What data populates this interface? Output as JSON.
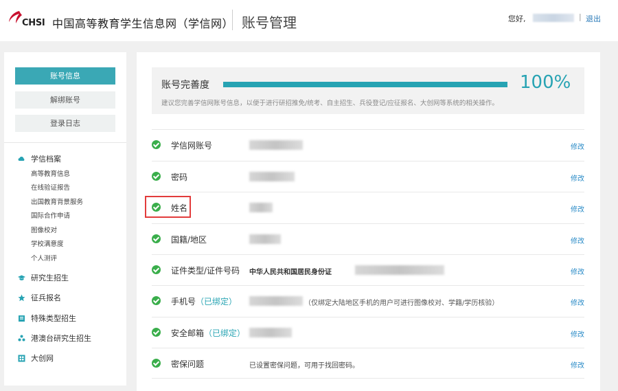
{
  "header": {
    "logo_text": "CHSI",
    "site_name": "中国高等教育学生信息网（学信网）",
    "page_title": "账号管理",
    "greeting": "您好,",
    "separator": "|",
    "logout_label": "退出"
  },
  "sidebar": {
    "buttons": [
      {
        "label": "账号信息",
        "active": true
      },
      {
        "label": "解绑账号",
        "active": false
      },
      {
        "label": "登录日志",
        "active": false
      }
    ],
    "categories": [
      {
        "label": "学信档案",
        "icon": "cloud-icon",
        "items": [
          "高等教育信息",
          "在线验证报告",
          "出国教育背景服务",
          "国际合作申请",
          "图像校对",
          "学校满意度",
          "个人测评"
        ]
      },
      {
        "label": "研究生招生",
        "icon": "graduation-cap-icon",
        "items": []
      },
      {
        "label": "征兵报名",
        "icon": "star-icon",
        "items": []
      },
      {
        "label": "特殊类型招生",
        "icon": "book-icon",
        "items": []
      },
      {
        "label": "港澳台研究生招生",
        "icon": "people-icon",
        "items": []
      },
      {
        "label": "大创网",
        "icon": "grid-icon",
        "items": []
      }
    ]
  },
  "main": {
    "completeness": {
      "label": "账号完善度",
      "value_text": "100%",
      "progress": 1.0,
      "hint": "建议您完善学信网账号信息，以便于进行研招推免/统考、自主招生、兵役登记/应征报名、大创网等系统的相关操作。"
    },
    "rows": [
      {
        "label": "学信网账号",
        "bound_note": "",
        "value_text": "",
        "edit_label": "修改"
      },
      {
        "label": "密码",
        "bound_note": "",
        "value_text": "",
        "edit_label": "修改"
      },
      {
        "label": "姓名",
        "bound_note": "",
        "value_text": "",
        "edit_label": "修改"
      },
      {
        "label": "国籍/地区",
        "bound_note": "",
        "value_text": "",
        "edit_label": "修改"
      },
      {
        "label": "证件类型/证件号码",
        "bound_note": "",
        "value_text": "中华人民共和国居民身份证",
        "edit_label": "修改"
      },
      {
        "label": "手机号",
        "bound_note": "（已绑定）",
        "value_text": "（仅绑定大陆地区手机的用户可进行图像校对、学籍/学历核验）",
        "edit_label": "修改"
      },
      {
        "label": "安全邮箱",
        "bound_note": "（已绑定）",
        "value_text": "",
        "edit_label": "修改"
      },
      {
        "label": "密保问题",
        "bound_note": "",
        "value_text": "已设置密保问题，可用于找回密码。",
        "edit_label": "修改"
      }
    ]
  },
  "colors": {
    "accent": "#27a3b3",
    "check_green": "#3aae4b",
    "link_blue": "#2a8bc7",
    "highlight_red": "#e23b3b"
  }
}
